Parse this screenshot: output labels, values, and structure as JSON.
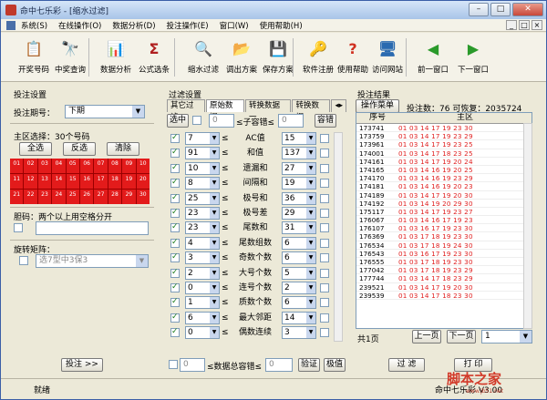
{
  "window": {
    "title": "命中七乐彩 - [缩水过滤]",
    "min": "–",
    "max": "□",
    "close": "✕"
  },
  "menu": [
    "系统(S)",
    "在线操作(O)",
    "数据分析(D)",
    "投注操作(E)",
    "窗口(W)",
    "使用帮助(H)"
  ],
  "mdi": [
    "_",
    "□",
    "×"
  ],
  "toolbar": [
    {
      "label": "开奖号码",
      "icon": "📋",
      "color": "#3a7ad8",
      "name": "lottery-number-tool"
    },
    {
      "label": "中奖查询",
      "icon": "🔭",
      "color": "#333",
      "name": "prize-query-tool"
    },
    {
      "label": "数据分析",
      "icon": "📊",
      "color": "#b03030",
      "name": "data-analysis-tool"
    },
    {
      "label": "公式选条",
      "icon": "Σ",
      "color": "#b02020",
      "name": "formula-tool"
    },
    {
      "label": "缩水过滤",
      "icon": "🔍",
      "color": "#2a6ab0",
      "name": "filter-tool"
    },
    {
      "label": "调出方案",
      "icon": "📂",
      "color": "#2a6ab0",
      "name": "load-plan-tool"
    },
    {
      "label": "保存方案",
      "icon": "💾",
      "color": "#2a6ab0",
      "name": "save-plan-tool"
    },
    {
      "label": "软件注册",
      "icon": "🔑",
      "color": "#c07020",
      "name": "register-tool"
    },
    {
      "label": "使用帮助",
      "icon": "?",
      "color": "#d03020",
      "name": "help-tool"
    },
    {
      "label": "访问网站",
      "icon": "🖥",
      "color": "#2a6ab0",
      "name": "website-tool"
    },
    {
      "label": "前一窗口",
      "icon": "◀",
      "color": "#2a9a2a",
      "name": "prev-window-tool"
    },
    {
      "label": "下一窗口",
      "icon": "▶",
      "color": "#2a9a2a",
      "name": "next-window-tool"
    }
  ],
  "left": {
    "section": "投注设置",
    "period_label": "投注期号：",
    "period_value": "下期",
    "main_label": "主区选择：30个号码",
    "btn_all": "全选",
    "btn_invert": "反选",
    "btn_clear": "清除",
    "grid": [
      "01",
      "02",
      "03",
      "04",
      "05",
      "06",
      "07",
      "08",
      "09",
      "10",
      "11",
      "12",
      "13",
      "14",
      "15",
      "16",
      "17",
      "18",
      "19",
      "20",
      "21",
      "22",
      "23",
      "24",
      "25",
      "26",
      "27",
      "28",
      "29",
      "30"
    ],
    "dan_label": "胆码：两个以上用空格分开",
    "matrix_label": "旋转矩阵：",
    "matrix_value": "选7型中3保3",
    "bet_button": "投注 >>"
  },
  "mid": {
    "section": "过滤设置",
    "tabs": [
      "其它过滤",
      "原始数据",
      "转换数据一",
      "转换数据"
    ],
    "tab_arrows": "◂▸",
    "top_select": "选中",
    "top_num": "0",
    "top_label": "≤子容错≤",
    "top_num2": "0",
    "top_btn": "容错",
    "rows": [
      {
        "a": "7",
        "name": "AC值",
        "b": "15"
      },
      {
        "a": "91",
        "name": "和值",
        "b": "137"
      },
      {
        "a": "10",
        "name": "遗漏和",
        "b": "27"
      },
      {
        "a": "8",
        "name": "间隔和",
        "b": "19"
      },
      {
        "a": "25",
        "name": "极号和",
        "b": "36"
      },
      {
        "a": "23",
        "name": "极号差",
        "b": "29"
      },
      {
        "a": "23",
        "name": "尾数和",
        "b": "31"
      },
      {
        "a": "4",
        "name": "尾数组数",
        "b": "6"
      },
      {
        "a": "3",
        "name": "奇数个数",
        "b": "6"
      },
      {
        "a": "2",
        "name": "大号个数",
        "b": "5"
      },
      {
        "a": "0",
        "name": "连号个数",
        "b": "2"
      },
      {
        "a": "1",
        "name": "质数个数",
        "b": "6"
      },
      {
        "a": "6",
        "name": "最大邻距",
        "b": "14"
      },
      {
        "a": "0",
        "name": "偶数连续",
        "b": "3"
      }
    ],
    "lt": "≤",
    "bottom_num": "0",
    "bottom_label": "≤数据总容错≤",
    "bottom_num2": "0",
    "btn_verify": "验证",
    "btn_extreme": "极值",
    "btn_filter": "过 滤"
  },
  "right": {
    "section": "投注结果",
    "menu_btn": "操作菜单",
    "count": "投注数：76 可恢复：2035724",
    "cols": [
      "序号",
      "主区"
    ],
    "rows": [
      [
        "173741",
        "01 03 14 17 19 23 30"
      ],
      [
        "173759",
        "01 03 14 17 19 23 29"
      ],
      [
        "173961",
        "01 03 14 17 19 23 25"
      ],
      [
        "174001",
        "01 03 14 17 18 23 25"
      ],
      [
        "174161",
        "01 03 14 17 19 20 24"
      ],
      [
        "174165",
        "01 03 14 16 19 20 25"
      ],
      [
        "174170",
        "01 03 14 16 19 23 29"
      ],
      [
        "174181",
        "01 03 14 16 19 20 23"
      ],
      [
        "174189",
        "01 03 14 17 19 20 30"
      ],
      [
        "174192",
        "01 03 14 19 20 29 30"
      ],
      [
        "175117",
        "01 03 14 17 19 23 27"
      ],
      [
        "176067",
        "01 03 14 16 17 19 23"
      ],
      [
        "176107",
        "01 03 16 17 19 23 30"
      ],
      [
        "176369",
        "01 03 17 18 19 23 30"
      ],
      [
        "176534",
        "01 03 17 18 19 24 30"
      ],
      [
        "176543",
        "01 03 16 17 19 23 30"
      ],
      [
        "176555",
        "01 03 17 18 19 23 30"
      ],
      [
        "177042",
        "01 03 17 18 19 23 29"
      ],
      [
        "177744",
        "01 03 14 17 18 23 29"
      ],
      [
        "239521",
        "01 03 14 17 19 20 30"
      ],
      [
        "239539",
        "01 03 14 17 18 23 30"
      ]
    ],
    "pages": "共1页",
    "btn_prev": "上一页",
    "btn_next": "下一页",
    "page_value": "1",
    "btn_print": "打 印"
  },
  "status": {
    "text": "就绪",
    "suffix": "命中七乐彩 V3.00"
  },
  "watermark": {
    "main": "脚本之家",
    "sub": "www.jb51.net"
  }
}
